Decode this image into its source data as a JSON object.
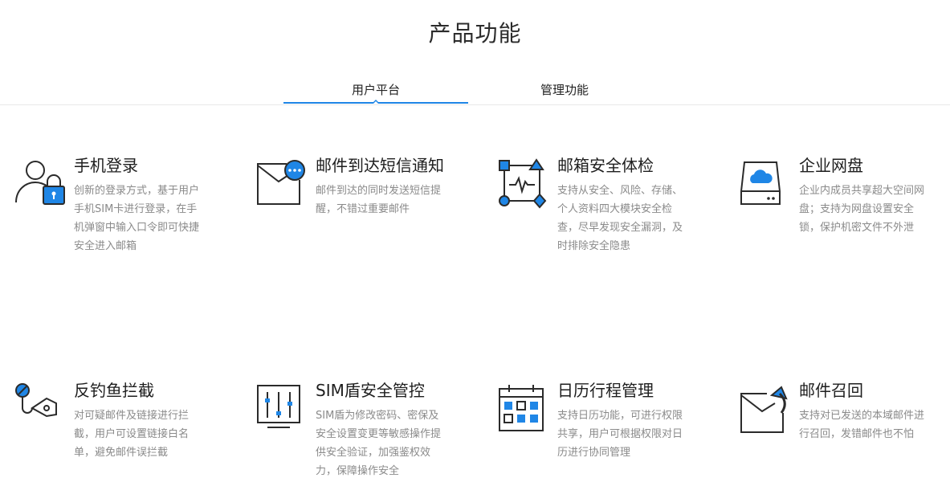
{
  "page": {
    "title": "产品功能"
  },
  "tabs": [
    {
      "label": "用户平台",
      "active": true
    },
    {
      "label": "管理功能",
      "active": false
    }
  ],
  "colors": {
    "accent": "#1f86e6",
    "icon_stroke": "#2b2b2b",
    "desc_text": "#8a8a8a"
  },
  "features": [
    {
      "title": "手机登录",
      "desc": "创新的登录方式，基于用户手机SIM卡进行登录，在手机弹窗中输入口令即可快捷安全进入邮箱",
      "icon": "user-lock-icon"
    },
    {
      "title": "邮件到达短信通知",
      "desc": "邮件到达的同时发送短信提醒，不错过重要邮件",
      "icon": "mail-message-icon"
    },
    {
      "title": "邮箱安全体检",
      "desc": "支持从安全、风险、存储、个人资料四大模块安全检查，尽早发现安全漏洞，及时排除安全隐患",
      "icon": "security-check-icon"
    },
    {
      "title": "企业网盘",
      "desc": "企业内成员共享超大空间网盘；支持为网盘设置安全锁，保护机密文件不外泄",
      "icon": "cloud-drive-icon"
    },
    {
      "title": "反钓鱼拦截",
      "desc": "对可疑邮件及链接进行拦截，用户可设置链接白名单，避免邮件误拦截",
      "icon": "anti-phishing-icon"
    },
    {
      "title": "SIM盾安全管控",
      "desc": "SIM盾为修改密码、密保及安全设置变更等敏感操作提供安全验证，加强鉴权效力，保障操作安全",
      "icon": "sim-shield-icon"
    },
    {
      "title": "日历行程管理",
      "desc": "支持日历功能，可进行权限共享，用户可根据权限对日历进行协同管理",
      "icon": "calendar-icon"
    },
    {
      "title": "邮件召回",
      "desc": "支持对已发送的本域邮件进行召回，发错邮件也不怕",
      "icon": "mail-recall-icon"
    }
  ]
}
